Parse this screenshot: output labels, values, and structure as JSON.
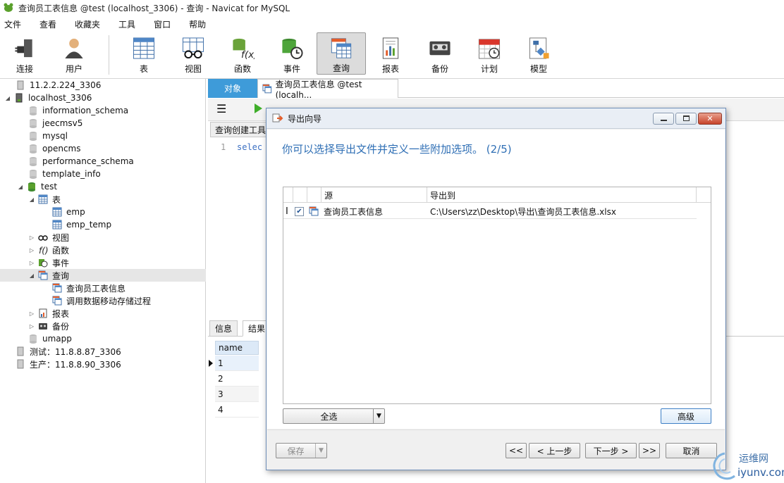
{
  "window": {
    "title": "查询员工表信息 @test (localhost_3306) - 查询 - Navicat for MySQL"
  },
  "menu": [
    "文件",
    "查看",
    "收藏夹",
    "工具",
    "窗口",
    "帮助"
  ],
  "toolbar": {
    "items": [
      {
        "label": "连接",
        "icon": "plug-icon"
      },
      {
        "label": "用户",
        "icon": "user-icon"
      },
      {
        "label": "表",
        "icon": "table-icon"
      },
      {
        "label": "视图",
        "icon": "view-glasses-icon"
      },
      {
        "label": "函数",
        "icon": "function-icon"
      },
      {
        "label": "事件",
        "icon": "event-clock-icon"
      },
      {
        "label": "查询",
        "icon": "query-icon"
      },
      {
        "label": "报表",
        "icon": "report-icon"
      },
      {
        "label": "备份",
        "icon": "backup-tape-icon"
      },
      {
        "label": "计划",
        "icon": "calendar-icon"
      },
      {
        "label": "模型",
        "icon": "model-icon"
      }
    ],
    "active": "查询"
  },
  "sidebar": {
    "connections": [
      {
        "label": "11.2.2.224_3306"
      },
      {
        "label": "localhost_3306"
      },
      {
        "label": "information_schema"
      },
      {
        "label": "jeecmsv5"
      },
      {
        "label": "mysql"
      },
      {
        "label": "opencms"
      },
      {
        "label": "performance_schema"
      },
      {
        "label": "template_info"
      },
      {
        "label": "test"
      },
      {
        "label": "表"
      },
      {
        "label": "emp"
      },
      {
        "label": "emp_temp"
      },
      {
        "label": "视图"
      },
      {
        "label": "函数"
      },
      {
        "label": "事件"
      },
      {
        "label": "查询"
      },
      {
        "label": "查询员工表信息"
      },
      {
        "label": "调用数据移动存储过程"
      },
      {
        "label": "报表"
      },
      {
        "label": "备份"
      },
      {
        "label": "umapp"
      },
      {
        "label": "测试：11.8.8.87_3306"
      },
      {
        "label": "生产：11.8.8.90_3306"
      }
    ]
  },
  "tabs": {
    "objects": "对象",
    "query": "查询员工表信息 @test (localh..."
  },
  "editor": {
    "subtab": "查询创建工具",
    "line": "1",
    "code": "selec"
  },
  "results": {
    "tabs": [
      "信息",
      "结果"
    ],
    "header": "name",
    "rows": [
      "1",
      "2",
      "3",
      "4"
    ]
  },
  "dialog": {
    "title": "导出向导",
    "heading": "你可以选择导出文件并定义一些附加选项。 (2/5)",
    "columns": {
      "source": "源",
      "export_to": "导出到"
    },
    "row": {
      "source": "查询员工表信息",
      "export_to": "C:\\Users\\zz\\Desktop\\导出\\查询员工表信息.xlsx",
      "checked": true
    },
    "buttons": {
      "select_all": "全选",
      "advanced": "高级",
      "save": "保存",
      "first": "<<",
      "prev": "< 上一步",
      "next": "下一步 >",
      "last": ">>",
      "cancel": "取消"
    }
  },
  "watermark": {
    "line1": "运维网",
    "line2": "iyunv.com"
  }
}
